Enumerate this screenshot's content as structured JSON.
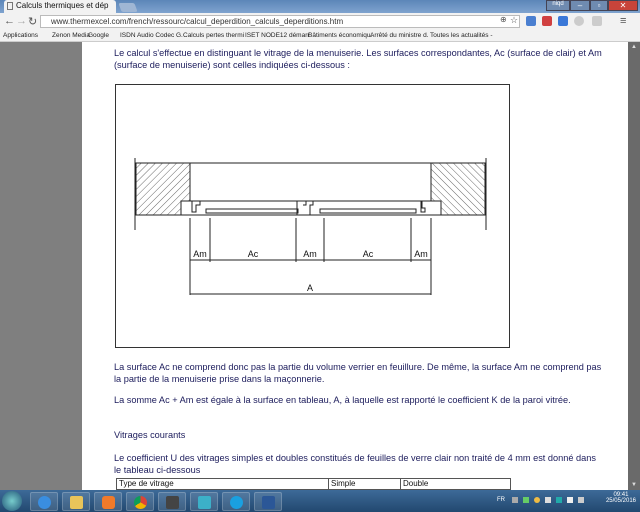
{
  "browser": {
    "tab_title": "Calculs thermiques et dép",
    "url": "www.thermexcel.com/french/ressourc/calcul_deperdition_calculs_deperditions.htm",
    "profile": "niqd",
    "bookmarks": [
      "Applications",
      "Zenon Media",
      "Google",
      "ISDN Audio Codec G.",
      "Calculs pertes thermi",
      "ISET NODE12 démarr",
      "Bâtiments économiqu.",
      "Arrêté du ministre d.",
      "Toutes les actualités -"
    ]
  },
  "content": {
    "para1": "Le calcul s'effectue en distinguant le vitrage de la menuiserie. Les surfaces correspondantes, Ac (surface de clair) et Am (surface de menuiserie) sont celles indiquées ci-dessous  :",
    "diagram_labels": {
      "am": "Am",
      "ac": "Ac",
      "a": "A"
    },
    "para2": "La surface Ac ne comprend donc pas la partie du volume verrier en feuillure. De même, la surface Am ne comprend pas la partie de la menuiserie prise dans la maçonnerie.",
    "para3": "La somme Ac  + Am est égale à la surface en tableau, A, à laquelle est rapporté le coefficient K de la paroi vitrée.",
    "para4": "Vitrages courants",
    "para5": "Le coefficient U des vitrages simples et doubles constitués de feuilles de verre clair non traité de 4 mm est donné dans le tableau ci-dessous",
    "table_headers": [
      "Type de vitrage",
      "Simple",
      "Double"
    ]
  },
  "taskbar": {
    "lang": "FR",
    "time": "09:41",
    "date": "25/05/2016"
  },
  "colors": {
    "text": "#1c1c5c",
    "taskbar": "#2c5580",
    "page_bg": "#7f7f7f"
  }
}
